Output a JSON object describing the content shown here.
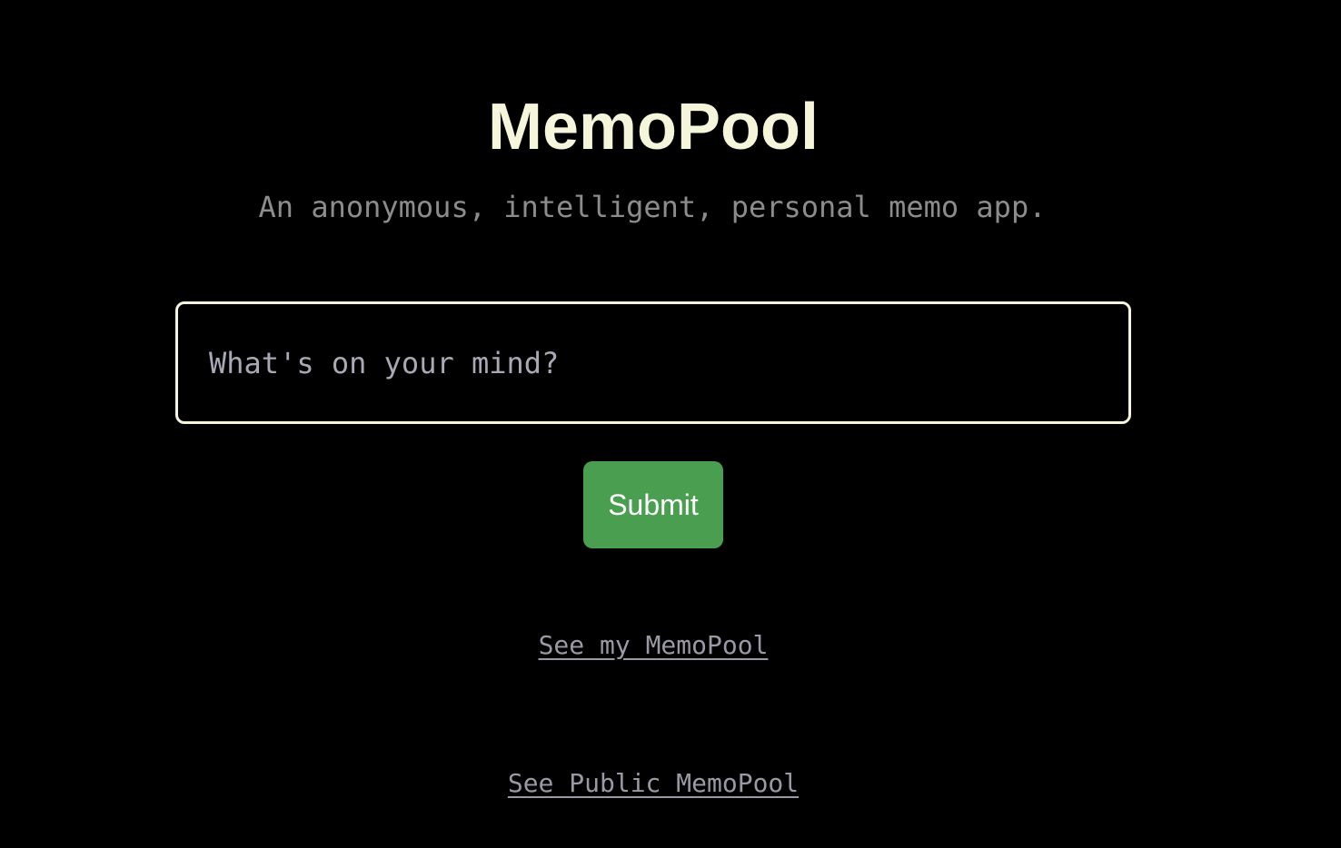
{
  "header": {
    "title": "MemoPool",
    "subtitle": "An anonymous, intelligent, personal memo app."
  },
  "memo_form": {
    "input_value": "",
    "input_placeholder": "What's on your mind?",
    "submit_label": "Submit"
  },
  "links": {
    "my_memopool": "See my MemoPool",
    "public_memopool": "See Public MemoPool"
  },
  "colors": {
    "background": "#000000",
    "title": "#f5f5dc",
    "accent_button": "#4a9e50",
    "input_border": "#f5f5dc",
    "link": "#9a9aa6"
  }
}
